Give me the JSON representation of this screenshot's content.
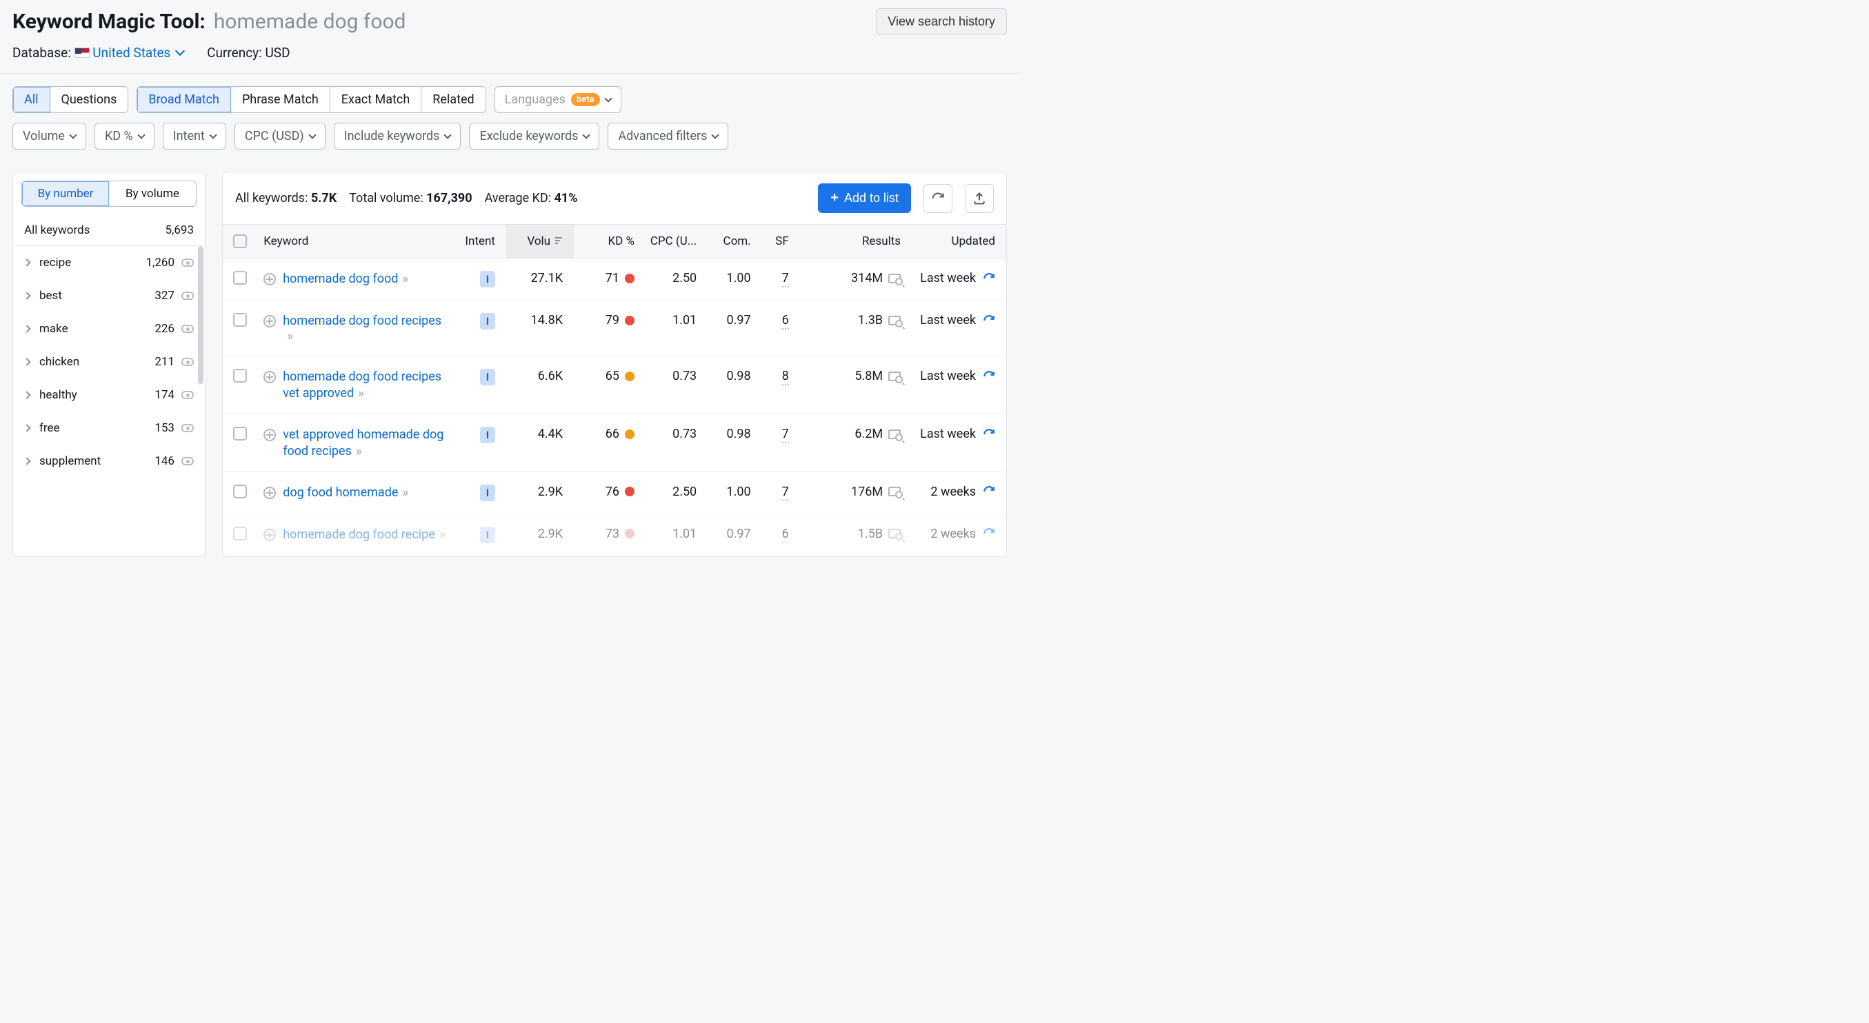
{
  "header": {
    "title": "Keyword Magic Tool:",
    "query": "homemade dog food",
    "history_btn": "View search history",
    "database_label": "Database:",
    "database_value": "United States",
    "currency_label": "Currency:",
    "currency_value": "USD"
  },
  "toolbar": {
    "row1_group1": [
      "All",
      "Questions"
    ],
    "row1_group1_active_index": 0,
    "row1_group2": [
      "Broad Match",
      "Phrase Match",
      "Exact Match",
      "Related"
    ],
    "row1_group2_active_index": 0,
    "languages_label": "Languages",
    "beta_label": "beta",
    "row2": [
      "Volume",
      "KD %",
      "Intent",
      "CPC (USD)",
      "Include keywords",
      "Exclude keywords",
      "Advanced filters"
    ]
  },
  "sidebar": {
    "toggle": [
      "By number",
      "By volume"
    ],
    "toggle_active_index": 0,
    "all_label": "All keywords",
    "all_count": "5,693",
    "groups": [
      {
        "label": "recipe",
        "count": "1,260"
      },
      {
        "label": "best",
        "count": "327"
      },
      {
        "label": "make",
        "count": "226"
      },
      {
        "label": "chicken",
        "count": "211"
      },
      {
        "label": "healthy",
        "count": "174"
      },
      {
        "label": "free",
        "count": "153"
      },
      {
        "label": "supplement",
        "count": "146"
      }
    ]
  },
  "summary": {
    "all_label": "All keywords:",
    "all_val": "5.7K",
    "vol_label": "Total volume:",
    "vol_val": "167,390",
    "kd_label": "Average KD:",
    "kd_val": "41%",
    "add_btn": "Add to list"
  },
  "columns": {
    "keyword": "Keyword",
    "intent": "Intent",
    "volume": "Volu",
    "kd": "KD %",
    "cpc": "CPC (U...",
    "com": "Com.",
    "sf": "SF",
    "results": "Results",
    "updated": "Updated"
  },
  "intent_badge_letter": "I",
  "rows": [
    {
      "keyword": "homemade dog food",
      "multiline": false,
      "volume": "27.1K",
      "kd": "71",
      "kd_color": "#e74c3c",
      "cpc": "2.50",
      "com": "1.00",
      "sf": "7",
      "results": "314M",
      "updated": "Last week",
      "faded": false
    },
    {
      "keyword": "homemade dog food recipes",
      "multiline": true,
      "volume": "14.8K",
      "kd": "79",
      "kd_color": "#e74c3c",
      "cpc": "1.01",
      "com": "0.97",
      "sf": "6",
      "results": "1.3B",
      "updated": "Last week",
      "faded": false
    },
    {
      "keyword": "homemade dog food recipes vet approved",
      "multiline": true,
      "volume": "6.6K",
      "kd": "65",
      "kd_color": "#f39c12",
      "cpc": "0.73",
      "com": "0.98",
      "sf": "8",
      "results": "5.8M",
      "updated": "Last week",
      "faded": false
    },
    {
      "keyword": "vet approved homemade dog food recipes",
      "multiline": true,
      "volume": "4.4K",
      "kd": "66",
      "kd_color": "#f39c12",
      "cpc": "0.73",
      "com": "0.98",
      "sf": "7",
      "results": "6.2M",
      "updated": "Last week",
      "faded": false
    },
    {
      "keyword": "dog food homemade",
      "multiline": false,
      "volume": "2.9K",
      "kd": "76",
      "kd_color": "#e74c3c",
      "cpc": "2.50",
      "com": "1.00",
      "sf": "7",
      "results": "176M",
      "updated": "2 weeks",
      "faded": false
    },
    {
      "keyword": "homemade dog food recipe",
      "multiline": true,
      "volume": "2.9K",
      "kd": "73",
      "kd_color": "#ef9a9a",
      "cpc": "1.01",
      "com": "0.97",
      "sf": "6",
      "results": "1.5B",
      "updated": "2 weeks",
      "faded": true
    }
  ]
}
